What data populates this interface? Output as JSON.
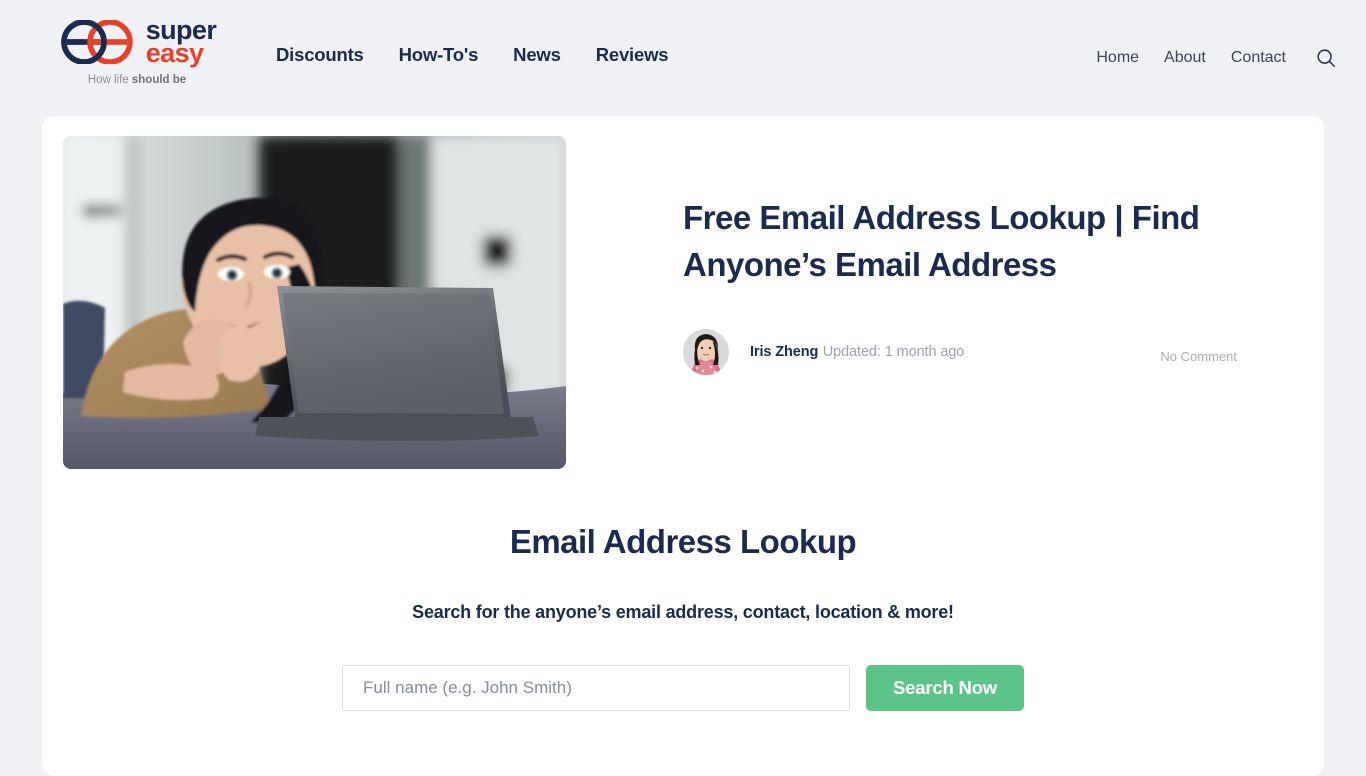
{
  "brand": {
    "name_line1": "super",
    "name_line2": "easy",
    "tagline_prefix": "How life ",
    "tagline_bold": "should be",
    "logo_navy": "#1b2a4e",
    "logo_red": "#e8402a"
  },
  "nav": {
    "primary": [
      {
        "label": "Discounts"
      },
      {
        "label": "How-To's"
      },
      {
        "label": "News"
      },
      {
        "label": "Reviews"
      }
    ],
    "utility": [
      {
        "label": "Home"
      },
      {
        "label": "About"
      },
      {
        "label": "Contact"
      }
    ],
    "search_icon": "search-icon"
  },
  "article": {
    "title": "Free Email Address Lookup | Find Anyone’s Email Address",
    "author": "Iris Zheng",
    "updated": "Updated: 1 month ago",
    "comments": "No Comment",
    "hero_image_alt": "woman-lying-on-bed-using-laptop"
  },
  "lookup": {
    "heading": "Email Address Lookup",
    "subheading": "Search for the anyone’s email address, contact, location & more!",
    "input_value": "",
    "input_placeholder": "Full name (e.g. John Smith)",
    "button_label": "Search Now",
    "button_color": "#5cc389"
  },
  "theme": {
    "page_background": "#f0f1f5",
    "card_background": "#ffffff",
    "heading_color": "#1b2a4e",
    "muted_color": "#9ea2ac"
  }
}
